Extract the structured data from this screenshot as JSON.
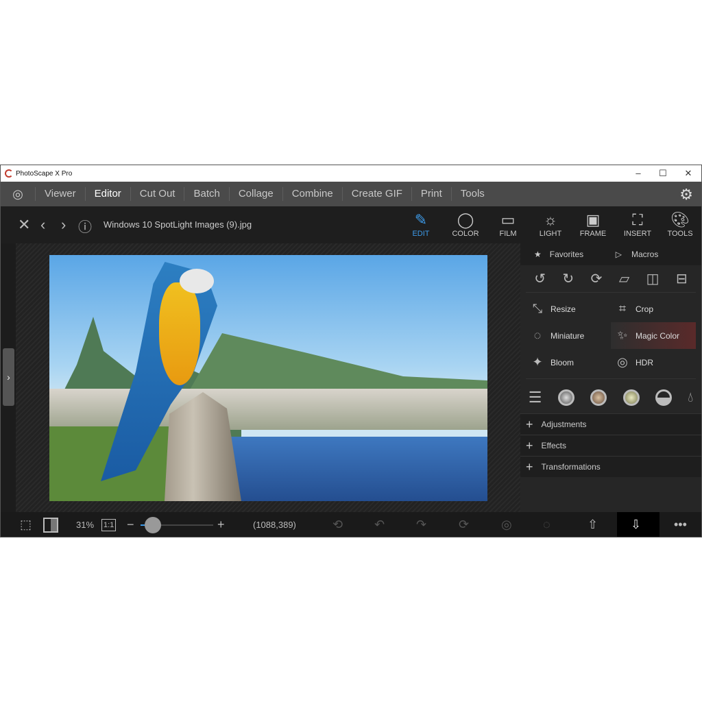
{
  "window": {
    "title": "PhotoScape X Pro",
    "minimize": "–",
    "maximize": "☐",
    "close": "✕"
  },
  "menu": {
    "items": [
      "Viewer",
      "Editor",
      "Cut Out",
      "Batch",
      "Collage",
      "Combine",
      "Create GIF",
      "Print",
      "Tools"
    ],
    "active": "Editor"
  },
  "toolbar": {
    "filename": "Windows 10 SpotLight Images (9).jpg",
    "tabs": [
      "EDIT",
      "COLOR",
      "FILM",
      "LIGHT",
      "FRAME",
      "INSERT",
      "TOOLS"
    ],
    "active_tab": "EDIT",
    "accent": "#3d9be9"
  },
  "panel": {
    "favorites": "Favorites",
    "macros": "Macros",
    "tools": [
      "Resize",
      "Crop",
      "Miniature",
      "Magic Color",
      "Bloom",
      "HDR"
    ],
    "highlighted": "Magic Color",
    "sections": [
      "Adjustments",
      "Effects",
      "Transformations"
    ]
  },
  "bottom": {
    "zoom": "31%",
    "one_to_one": "1:1",
    "coords": "(1088,389)",
    "zoom_slider_percent": 10
  }
}
